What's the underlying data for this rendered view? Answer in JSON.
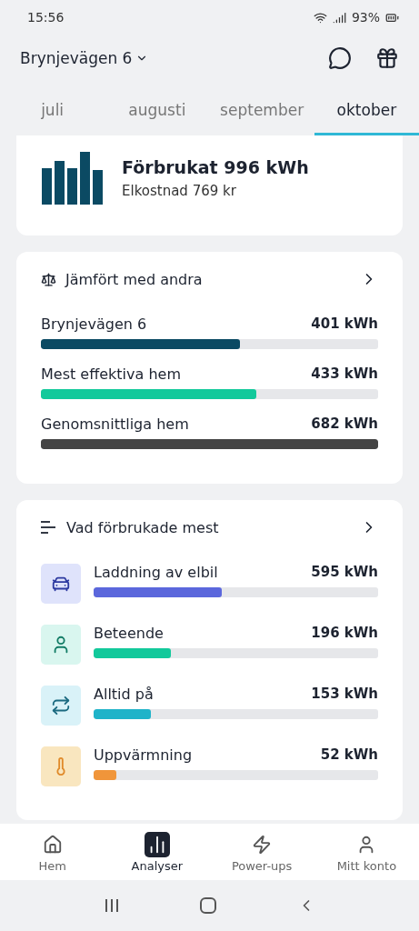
{
  "status_bar": {
    "time": "15:56",
    "battery": "93%"
  },
  "header": {
    "address": "Brynjevägen 6"
  },
  "tabs": [
    {
      "label": "juli",
      "selected": false
    },
    {
      "label": "augusti",
      "selected": false
    },
    {
      "label": "september",
      "selected": false
    },
    {
      "label": "oktober",
      "selected": true
    }
  ],
  "summary": {
    "title": "Förbrukat 996 kWh",
    "subtitle": "Elkostnad 769 kr"
  },
  "comparison": {
    "title": "Jämfört med andra",
    "rows": [
      {
        "label": "Brynjevägen 6",
        "value": "401 kWh",
        "level": 0.59,
        "color": "#0b4a63"
      },
      {
        "label": "Mest effektiva hem",
        "value": "433 kWh",
        "level": 0.64,
        "color": "#12c99b"
      },
      {
        "label": "Genomsnittliga hem",
        "value": "682 kWh",
        "level": 1.0,
        "color": "#444444"
      }
    ]
  },
  "categories": {
    "title": "Vad förbrukade mest",
    "rows": [
      {
        "kind": "car",
        "label": "Laddning av elbil",
        "value": "595 kWh",
        "level": 0.45,
        "color": "#5b67dc"
      },
      {
        "kind": "person",
        "label": "Beteende",
        "value": "196 kWh",
        "level": 0.27,
        "color": "#12c99b"
      },
      {
        "kind": "repeat",
        "label": "Alltid på",
        "value": "153 kWh",
        "level": 0.2,
        "color": "#1fb3c9"
      },
      {
        "kind": "heat",
        "label": "Uppvärmning",
        "value": "52 kWh",
        "level": 0.08,
        "color": "#f0953a"
      }
    ]
  },
  "bottom_nav": [
    {
      "kind": "home",
      "label": "Hem",
      "selected": false
    },
    {
      "kind": "chart",
      "label": "Analyser",
      "selected": true
    },
    {
      "kind": "bolt",
      "label": "Power-ups",
      "selected": false
    },
    {
      "kind": "user",
      "label": "Mitt konto",
      "selected": false
    }
  ]
}
